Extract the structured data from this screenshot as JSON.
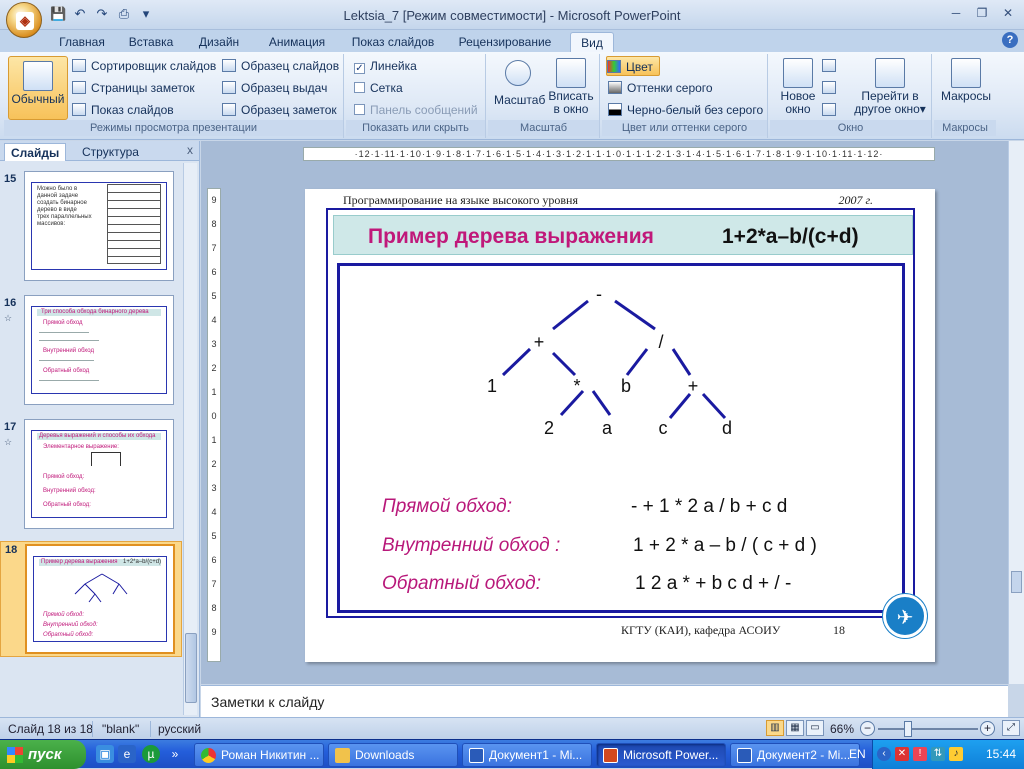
{
  "window": {
    "title": "Lektsia_7 [Режим совместимости] - Microsoft PowerPoint"
  },
  "ribbon_tabs": [
    {
      "label": "Главная"
    },
    {
      "label": "Вставка"
    },
    {
      "label": "Дизайн"
    },
    {
      "label": "Анимация"
    },
    {
      "label": "Показ слайдов"
    },
    {
      "label": "Рецензирование"
    },
    {
      "label": "Вид"
    }
  ],
  "ribbon": {
    "views": {
      "normal": "Обычный",
      "sorter": "Сортировщик слайдов",
      "notes_page": "Страницы заметок",
      "slideshow": "Показ слайдов",
      "slide_master": "Образец слайдов",
      "handout_master": "Образец выдач",
      "notes_master": "Образец заметок",
      "group": "Режимы просмотра презентации"
    },
    "show": {
      "ruler": "Линейка",
      "grid": "Сетка",
      "msgbar": "Панель сообщений",
      "group": "Показать или скрыть"
    },
    "zoom": {
      "zoom": "Масштаб",
      "fit_line1": "Вписать",
      "fit_line2": "в окно",
      "group": "Масштаб"
    },
    "color": {
      "color": "Цвет",
      "gray": "Оттенки серого",
      "bw": "Черно-белый без серого",
      "group": "Цвет или оттенки серого"
    },
    "window": {
      "new_line1": "Новое",
      "new_line2": "окно",
      "switch_line1": "Перейти в",
      "switch_line2": "другое окно",
      "group": "Окно"
    },
    "macros": {
      "macros": "Макросы",
      "group": "Макросы"
    }
  },
  "left_pane": {
    "tabs": [
      "Слайды",
      "Структура"
    ],
    "close": "x",
    "slides": [
      {
        "num": "15",
        "mark": ""
      },
      {
        "num": "16",
        "mark": "☆"
      },
      {
        "num": "17",
        "mark": "☆"
      },
      {
        "num": "18",
        "mark": ""
      }
    ],
    "thumb15": [
      "Можно было в",
      "данной задаче",
      "создать бинарное",
      "дерево в  виде",
      "трех параллельных",
      "массивов:"
    ],
    "thumb16": [
      "Три способа обхода бинарного дерева",
      "Прямой обход",
      "Внутренний обход",
      "Обратный обход"
    ],
    "thumb17": [
      "Деревья выражений и способы их обхода",
      "Элементарное выражение:",
      "Прямой обход:",
      "Внутренний обход:",
      "Обратный обход:"
    ],
    "thumb18": [
      "Пример дерева выражения",
      "1+2*a–b/(c+d)",
      "Прямой обход:",
      "Внутренний обход:",
      "Обратный обход:"
    ]
  },
  "ruler": {
    "h_text": "·12·1·11·1·10·1·9·1·8·1·7·1·6·1·5·1·4·1·3·1·2·1·1·1·0·1·1·1·2·1·3·1·4·1·5·1·6·1·7·1·8·1·9·1·10·1·11·1·12·"
  },
  "slide": {
    "header_left": "Программирование  на  языке высокого  уровня",
    "header_right": "2007 г.",
    "title": "Пример дерева выражения",
    "expression": "1+2*a–b/(c+d)",
    "tree": {
      "root": "-",
      "plus1": "+",
      "div": "/",
      "one": "1",
      "mul": "*",
      "b": "b",
      "plus2": "+",
      "two": "2",
      "a": "a",
      "c": "c",
      "d": "d"
    },
    "traversals": [
      {
        "label": "Прямой обход:",
        "value": "- + 1 * 2 a / b + c d"
      },
      {
        "label": "Внутренний обход :",
        "value": "1 + 2 * a – b / ( c + d )"
      },
      {
        "label": "Обратный обход:",
        "value": "1 2 a * + b c d + / -"
      }
    ],
    "footer": "КГТУ  (КАИ),  кафедра АСОИУ",
    "page": "18"
  },
  "notes": {
    "placeholder": "Заметки к слайду"
  },
  "status": {
    "slide": "Слайд 18 из 18",
    "theme": "\"blank\"",
    "lang": "русский",
    "zoom": "66%"
  },
  "taskbar": {
    "start": "пуск",
    "buttons": [
      "Роман Никитин ...",
      "Downloads",
      "Документ1 - Mi...",
      "Microsoft Power...",
      "Документ2 - Mi..."
    ],
    "lang": "EN",
    "time": "15:44"
  },
  "colors": {
    "accent": "#c0187a",
    "frame": "#1a1aa0",
    "title_band": "#cfe8e8"
  }
}
